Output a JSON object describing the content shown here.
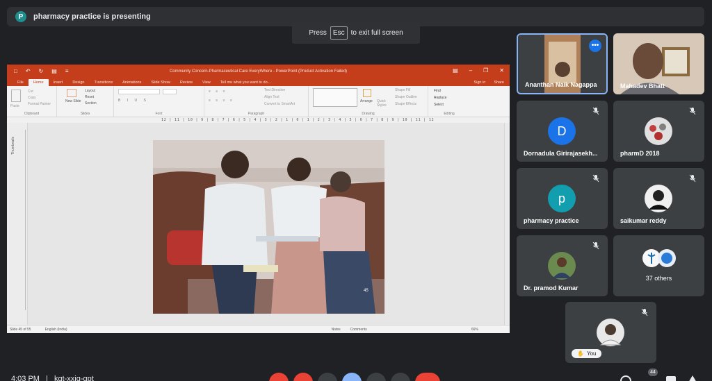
{
  "presenting_bar": {
    "avatar_letter": "P",
    "text": "pharmacy practice is presenting"
  },
  "esc_hint": {
    "before": "Press",
    "key": "Esc",
    "after": "to exit full screen"
  },
  "powerpoint": {
    "title": "Community Concern-Pharmaceutical Care EveryWhere - PowerPoint (Product Activation Failed)",
    "tabs": [
      "File",
      "Home",
      "Insert",
      "Design",
      "Transitions",
      "Animations",
      "Slide Show",
      "Review",
      "View"
    ],
    "active_tab": "Home",
    "tell_me": "Tell me what you want to do...",
    "sign_in": "Sign in",
    "share": "Share",
    "ribbon_groups": {
      "clipboard": {
        "label": "Clipboard",
        "items": [
          "Paste",
          "Cut",
          "Copy",
          "Format Painter"
        ]
      },
      "slides": {
        "label": "Slides",
        "items": [
          "New Slide",
          "Layout",
          "Reset",
          "Section"
        ]
      },
      "font": {
        "label": "Font"
      },
      "paragraph": {
        "label": "Paragraph",
        "items": [
          "Text Direction",
          "Align Text",
          "Convert to SmartArt"
        ]
      },
      "drawing": {
        "label": "Drawing",
        "items": [
          "Arrange",
          "Quick Styles",
          "Shape Fill",
          "Shape Outline",
          "Shape Effects"
        ]
      },
      "editing": {
        "label": "Editing",
        "items": [
          "Find",
          "Replace",
          "Select"
        ]
      }
    },
    "ruler_text": "12 | 11 | 10 | 9 | 8 | 7 | 6 | 5 | 4 | 3 | 2 | 1 | 0 | 1 | 2 | 3 | 4 | 5 | 6 | 7 | 8 | 9 | 10 | 11 | 12",
    "thumbnails_label": "Thumbnails",
    "slide_number_on_image": "45",
    "status": {
      "slide": "Slide 45 of 55",
      "language": "English (India)",
      "notes": "Notes",
      "comments": "Comments",
      "zoom": "66%"
    }
  },
  "participants": [
    {
      "name": "Ananthan Naik Nagappa",
      "type": "video",
      "muted": false,
      "pinned_menu": true
    },
    {
      "name": "Mahadev Bhatt",
      "type": "video",
      "muted": false
    },
    {
      "name": "Dornadula Girirajasekh...",
      "type": "letter",
      "letter": "D",
      "color": "#1a73e8",
      "muted": true
    },
    {
      "name": "pharmD 2018",
      "type": "photo",
      "muted": true
    },
    {
      "name": "pharmacy practice",
      "type": "letter",
      "letter": "p",
      "color": "#129eaf",
      "muted": true
    },
    {
      "name": "saikumar reddy",
      "type": "photo",
      "muted": true
    },
    {
      "name": "Dr. pramod Kumar",
      "type": "photo",
      "muted": true
    },
    {
      "name": "37 others",
      "type": "group",
      "muted": false
    },
    {
      "name": "You",
      "type": "self",
      "muted": true
    }
  ],
  "bottom_bar": {
    "time": "4:03 PM",
    "meeting_code": "kgt-xxjg-gpt",
    "participant_count": "44"
  },
  "colors": {
    "background": "#202124",
    "tile": "#3c4043",
    "ppt_accent": "#c43e1c",
    "end_call": "#ea4335",
    "mic_off": "#ea4335",
    "active_blue": "#8ab4f8"
  }
}
